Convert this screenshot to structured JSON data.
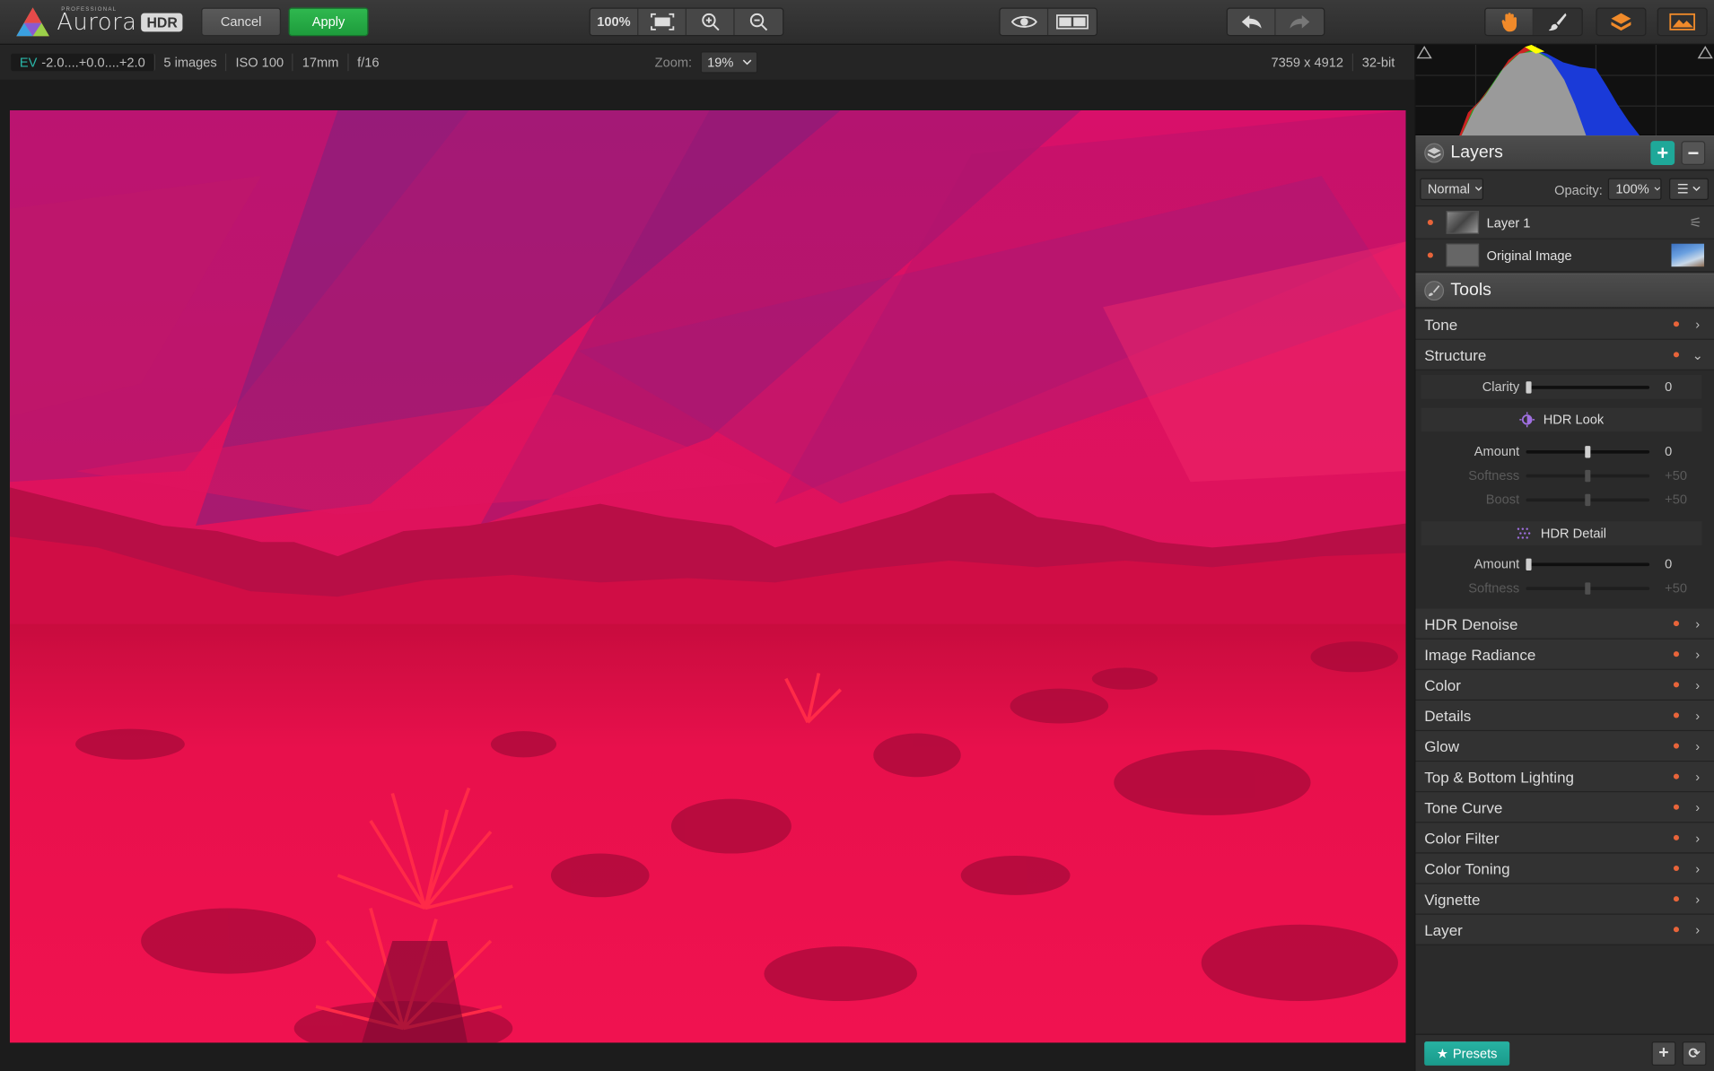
{
  "app": {
    "name": "Aurora",
    "badge": "HDR",
    "edition": "PROFESSIONAL"
  },
  "toolbar": {
    "cancel_label": "Cancel",
    "apply_label": "Apply",
    "zoom_100_label": "100%",
    "icons": [
      "fit-screen-icon",
      "zoom-in-icon",
      "zoom-out-icon",
      "eye-icon",
      "compare-icon",
      "undo-icon",
      "redo-icon",
      "hand-icon",
      "brush-icon",
      "layers-icon",
      "image-icon"
    ]
  },
  "infobar": {
    "ev_tag": "EV",
    "ev_range": "-2.0....+0.0....+2.0",
    "images": "5 images",
    "iso": "ISO 100",
    "focal": "17mm",
    "aperture": "f/16",
    "zoom_label": "Zoom:",
    "zoom_value": "19%",
    "dimensions": "7359 x 4912",
    "bit_depth": "32-bit"
  },
  "layers": {
    "title": "Layers",
    "blend_mode": "Normal",
    "opacity_label": "Opacity:",
    "opacity_value": "100%",
    "items": [
      {
        "name": "Layer 1"
      },
      {
        "name": "Original Image"
      }
    ]
  },
  "tools": {
    "title": "Tools",
    "tone": "Tone",
    "structure": "Structure",
    "clarity": {
      "label": "Clarity",
      "value": "0",
      "level": 0.0
    },
    "hdr_look": {
      "title": "HDR Look",
      "amount": {
        "label": "Amount",
        "value": "0",
        "level": 0.5
      },
      "softness": {
        "label": "Softness",
        "value": "+50",
        "level": 0.5
      },
      "boost": {
        "label": "Boost",
        "value": "+50",
        "level": 0.5
      }
    },
    "hdr_detail": {
      "title": "HDR Detail",
      "amount": {
        "label": "Amount",
        "value": "0",
        "level": 0.0
      },
      "softness": {
        "label": "Softness",
        "value": "+50",
        "level": 0.5
      }
    },
    "items": [
      "HDR Denoise",
      "Image Radiance",
      "Color",
      "Details",
      "Glow",
      "Top & Bottom Lighting",
      "Tone Curve",
      "Color Filter",
      "Color Toning",
      "Vignette",
      "Layer"
    ]
  },
  "footer": {
    "presets_label": "Presets"
  },
  "colors": {
    "accent_teal": "#1fa899",
    "apply_green": "#22a844",
    "dot_orange": "#e8643a",
    "photo_tint": "#e8104b"
  }
}
